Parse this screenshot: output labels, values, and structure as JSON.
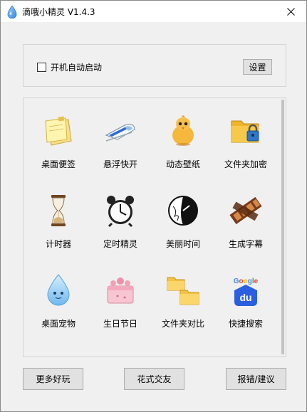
{
  "window": {
    "title": "滴哦小精灵 V1.4.3"
  },
  "autostart": {
    "checkbox_label": "开机自动启动",
    "checked": false,
    "settings_label": "设置"
  },
  "tools": [
    {
      "label": "桌面便签",
      "icon": "sticky-notes-icon"
    },
    {
      "label": "悬浮快开",
      "icon": "bullet-train-icon"
    },
    {
      "label": "动态壁纸",
      "icon": "chick-icon"
    },
    {
      "label": "文件夹加密",
      "icon": "locked-folder-icon"
    },
    {
      "label": "计时器",
      "icon": "hourglass-icon"
    },
    {
      "label": "定时精灵",
      "icon": "alarm-clock-icon"
    },
    {
      "label": "美丽时间",
      "icon": "art-clock-icon"
    },
    {
      "label": "生成字幕",
      "icon": "film-strip-icon"
    },
    {
      "label": "桌面宠物",
      "icon": "water-drop-pet-icon"
    },
    {
      "label": "生日节日",
      "icon": "gift-cake-icon"
    },
    {
      "label": "文件夹对比",
      "icon": "folder-compare-icon"
    },
    {
      "label": "快捷搜索",
      "icon": "baidu-search-icon"
    }
  ],
  "footer": {
    "more_fun": "更多好玩",
    "make_friends": "花式交友",
    "report": "报错/建议"
  },
  "colors": {
    "title_bar": "#ffffff",
    "client_bg": "#f0f0f0",
    "button_bg": "#e1e1e1",
    "button_border": "#adadad",
    "accent_blue": "#3a8ee6"
  }
}
